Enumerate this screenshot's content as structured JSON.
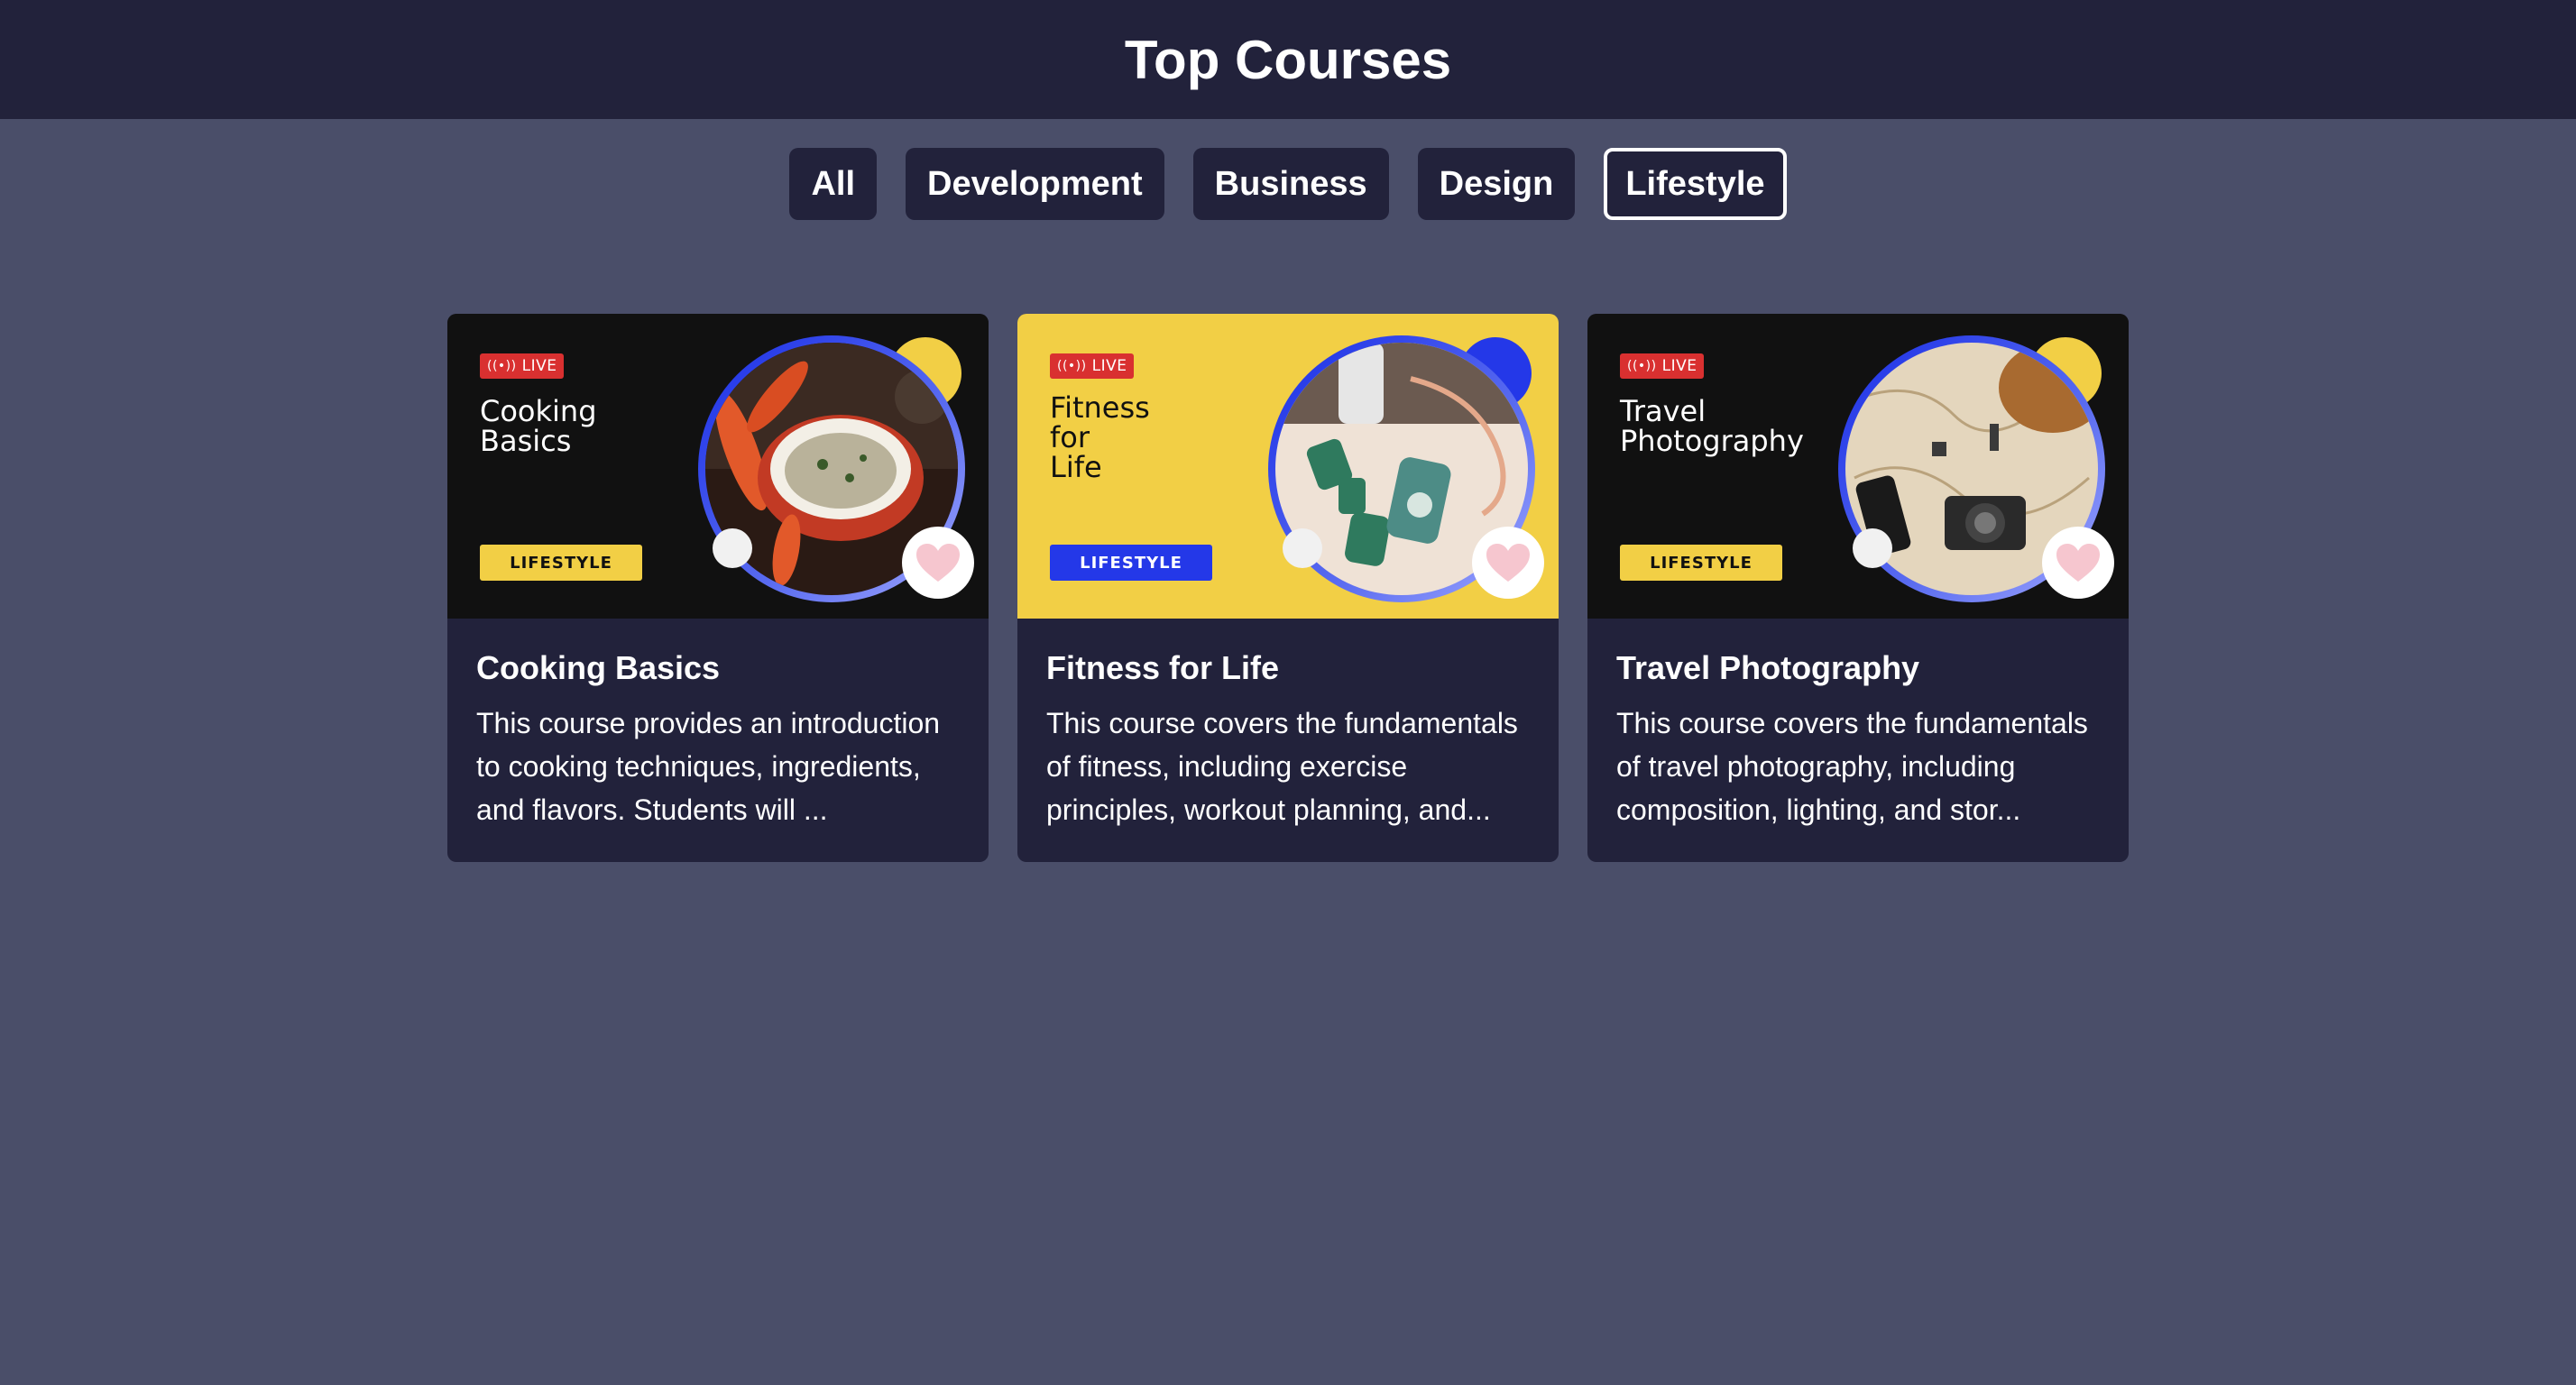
{
  "header": {
    "title": "Top Courses"
  },
  "filters": [
    {
      "label": "All",
      "active": false
    },
    {
      "label": "Development",
      "active": false
    },
    {
      "label": "Business",
      "active": false
    },
    {
      "label": "Design",
      "active": false
    },
    {
      "label": "Lifestyle",
      "active": true
    }
  ],
  "courses": [
    {
      "thumb_badge": "LIVE",
      "thumb_title_lines": [
        "Cooking",
        "Basics"
      ],
      "thumb_category": "LIFESTYLE",
      "title": "Cooking Basics",
      "description": "This course provides an introduction to cooking techniques, ingredients, and flavors. Students will ...",
      "photo_icon": "cooking-pot-photo"
    },
    {
      "thumb_badge": "LIVE",
      "thumb_title_lines": [
        "Fitness",
        "for",
        "Life"
      ],
      "thumb_category": "LIFESTYLE",
      "title": "Fitness for Life",
      "description": "This course covers the fundamentals of fitness, including exercise principles, workout planning, and...",
      "photo_icon": "dumbbells-photo"
    },
    {
      "thumb_badge": "LIVE",
      "thumb_title_lines": [
        "Travel",
        "Photography"
      ],
      "thumb_category": "LIFESTYLE",
      "title": "Travel Photography",
      "description": "This course covers the fundamentals of travel photography, including composition, lighting, and stor...",
      "photo_icon": "camera-map-photo"
    }
  ],
  "colors": {
    "page_bg": "#4a4e69",
    "header_bg": "#22223b",
    "card_bg": "#22223b",
    "accent_yellow": "#f2cf45",
    "accent_blue": "#2438e8",
    "live_red": "#d93030",
    "heart_pink": "#f6c6cf"
  }
}
